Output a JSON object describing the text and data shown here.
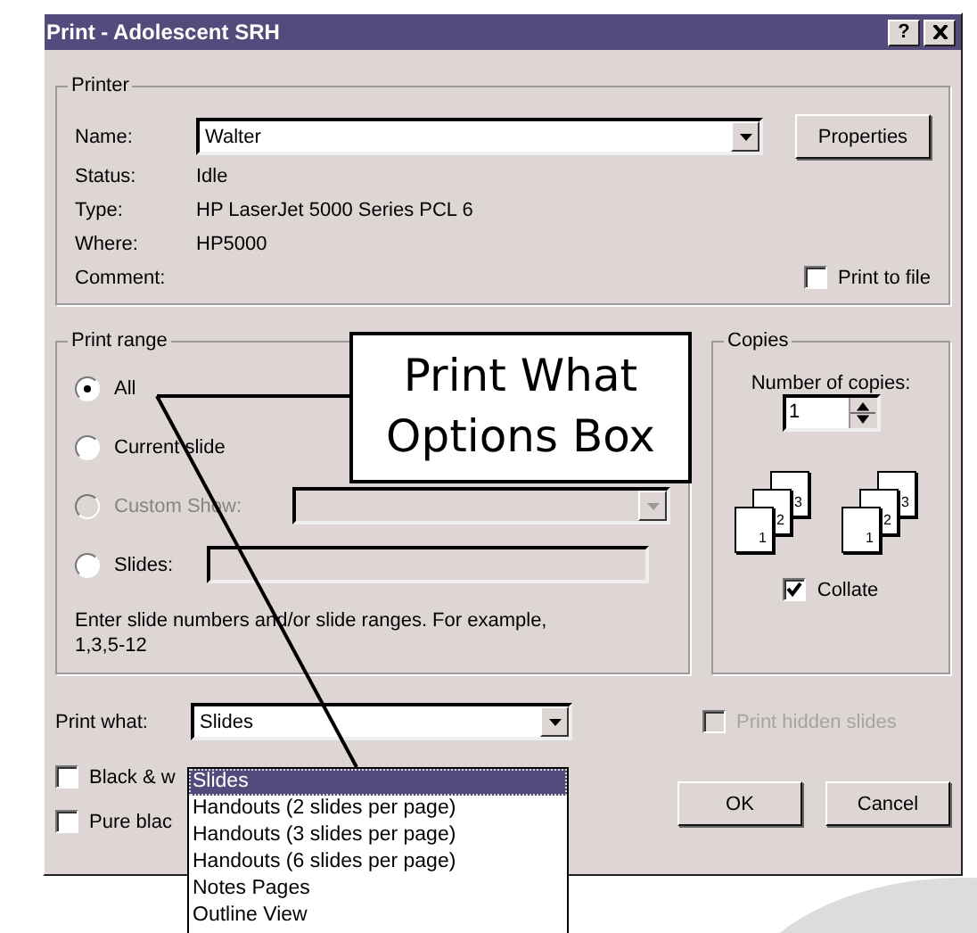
{
  "window": {
    "title": "Print - Adolescent SRH",
    "help": "?"
  },
  "printer": {
    "group": "Printer",
    "name_label": "Name:",
    "name_value": "Walter",
    "properties": "Properties",
    "info": [
      {
        "label": "Status:",
        "value": "Idle"
      },
      {
        "label": "Type:",
        "value": "HP LaserJet 5000 Series PCL 6"
      },
      {
        "label": "Where:",
        "value": "HP5000"
      },
      {
        "label": "Comment:"
      }
    ],
    "print_to_file": {
      "label": "Print to file",
      "checked": false
    }
  },
  "print_range": {
    "group": "Print range",
    "options": [
      {
        "kind": "plain",
        "label": "All",
        "selected": true,
        "disabled": false
      },
      {
        "kind": "plain",
        "label": "Current slide",
        "selected": false,
        "disabled": false
      },
      {
        "kind": "dropdown",
        "label": "Custom Show:",
        "selected": false,
        "disabled": true
      },
      {
        "kind": "field",
        "label": "Slides:",
        "selected": false,
        "disabled": false
      }
    ],
    "hint": "Enter slide numbers and/or slide ranges. For example, 1,3,5-12"
  },
  "copies": {
    "group": "Copies",
    "label": "Number of copies:",
    "value": "1",
    "stacks": [
      [
        "1",
        "2",
        "3"
      ],
      [
        "1",
        "2",
        "3"
      ]
    ],
    "collate": {
      "label": "Collate",
      "checked": true
    }
  },
  "print_what": {
    "label": "Print what:",
    "value": "Slides",
    "options": [
      {
        "label": "Slides",
        "selected": true
      },
      {
        "label": "Handouts (2 slides per page)",
        "selected": false
      },
      {
        "label": "Handouts (3 slides per page)",
        "selected": false
      },
      {
        "label": "Handouts (6 slides per page)",
        "selected": false
      },
      {
        "label": "Notes Pages",
        "selected": false
      },
      {
        "label": "Outline View",
        "selected": false
      }
    ],
    "hidden_slides": {
      "label": "Print hidden slides",
      "checked": false,
      "disabled": true
    }
  },
  "checkboxes": [
    {
      "label": "Black & w",
      "checked": false
    },
    {
      "label": "Pure blac",
      "checked": false
    }
  ],
  "buttons": [
    "OK",
    "Cancel"
  ],
  "callout": {
    "text": "Print What Options Box"
  }
}
